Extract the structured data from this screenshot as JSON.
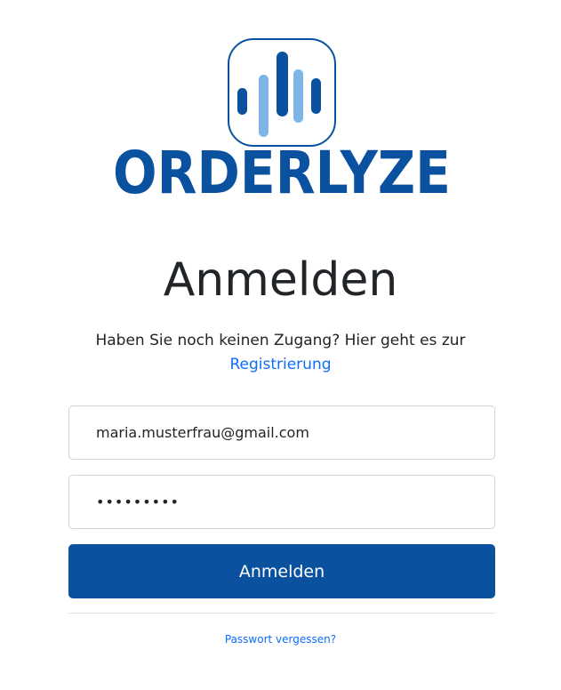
{
  "logo": {
    "wordmark": "ORDERLYZE",
    "mark_icon": "equalizer-bars-icon",
    "colors": {
      "primary": "#0a51a0",
      "light": "#7db6e6"
    }
  },
  "page": {
    "title": "Anmelden",
    "subtitle": "Haben Sie noch keinen Zugang? Hier geht es zur",
    "register_link": "Registrierung"
  },
  "form": {
    "email_value": "maria.musterfrau@gmail.com",
    "password_value": "•••••••••",
    "submit_label": "Anmelden",
    "forgot_link": "Passwort vergessen?"
  },
  "colors": {
    "button": "#0a51a0",
    "link": "#0d6efd",
    "text": "#212529",
    "border": "#cfd3d8"
  }
}
